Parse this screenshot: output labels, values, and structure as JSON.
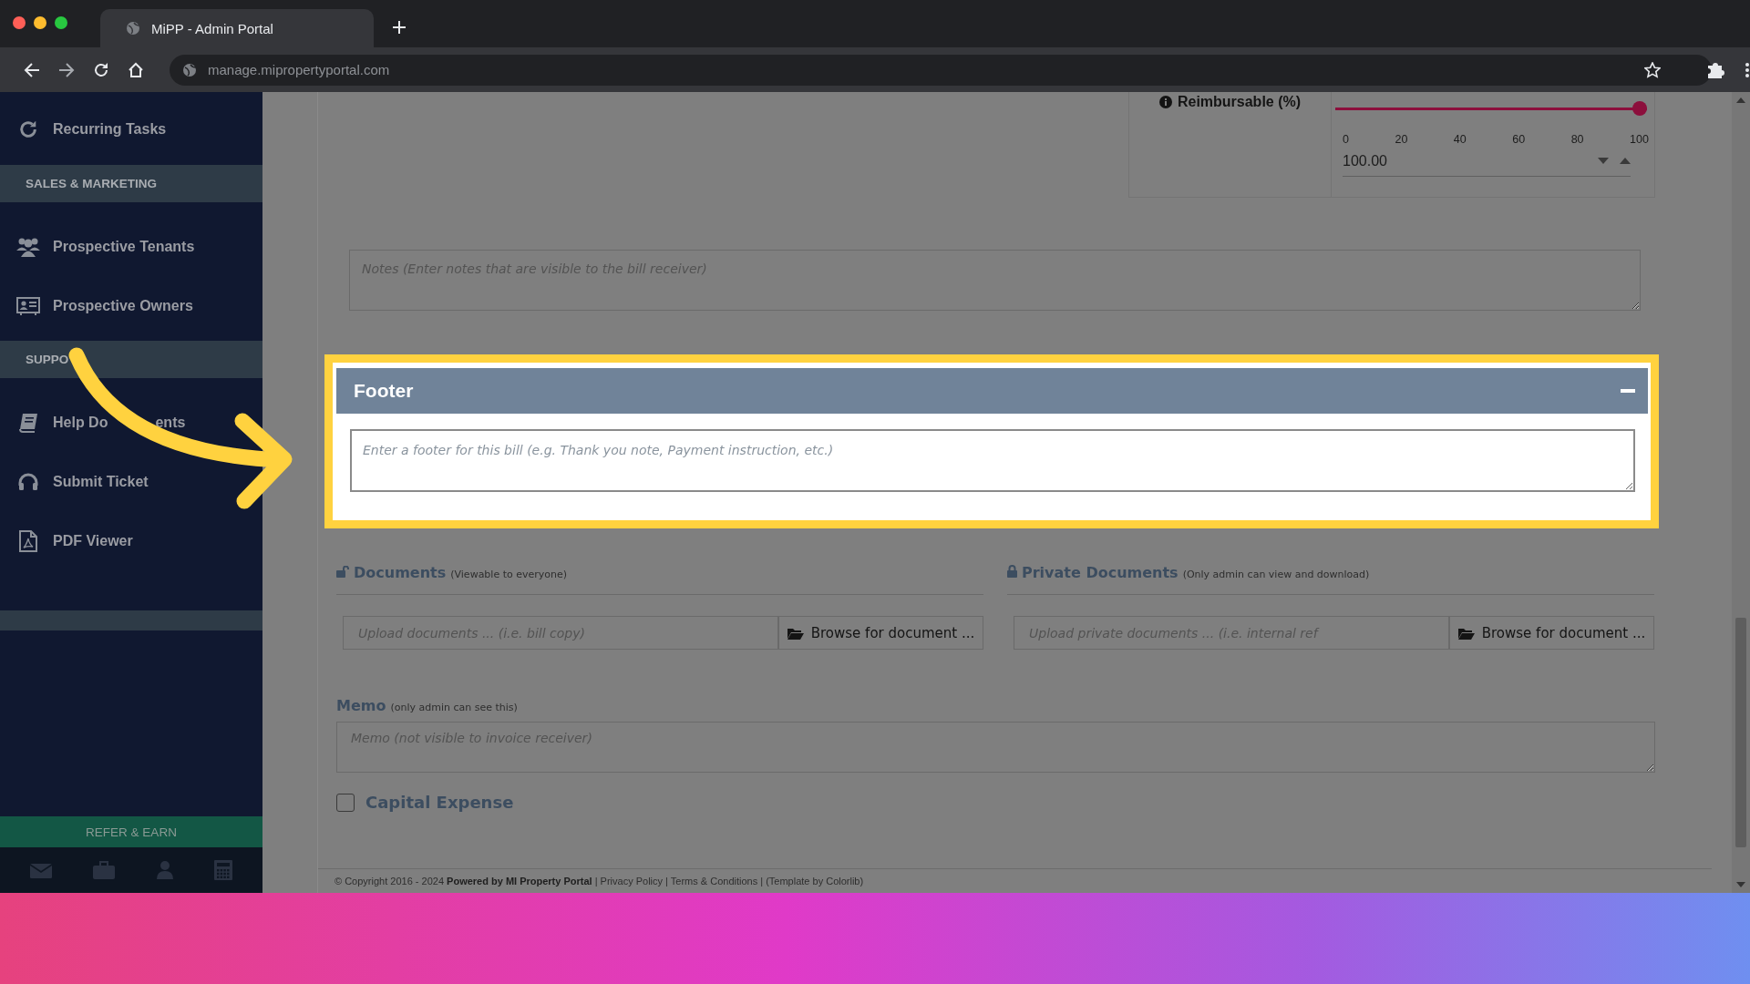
{
  "browser": {
    "tab_title": "MiPP - Admin Portal",
    "url": "manage.mipropertyportal.com"
  },
  "sidebar": {
    "items": [
      {
        "kind": "item",
        "label": "Recurring Tasks"
      },
      {
        "kind": "header",
        "label": "SALES & MARKETING"
      },
      {
        "kind": "item",
        "label": "Prospective Tenants"
      },
      {
        "kind": "item",
        "label": "Prospective Owners"
      },
      {
        "kind": "header",
        "label": "SUPPO"
      },
      {
        "kind": "item",
        "label": "Help Do",
        "label_tail": "ents"
      },
      {
        "kind": "item",
        "label": "Submit Ticket"
      },
      {
        "kind": "item",
        "label": "PDF Viewer"
      },
      {
        "kind": "divider"
      }
    ],
    "refer_button": "REFER & EARN"
  },
  "reimbursable": {
    "label": "Reimbursable (%)",
    "level": 1,
    "ticks": [
      "0",
      "20",
      "40",
      "60",
      "80",
      "100"
    ],
    "value": "100.00"
  },
  "notes": {
    "placeholder": "Notes (Enter notes that are visible to the bill receiver)"
  },
  "footer_panel": {
    "title": "Footer",
    "highlighted": true,
    "expanded": true,
    "placeholder": "Enter a footer for this bill (e.g. Thank you note, Payment instruction, etc.)"
  },
  "documents": [
    {
      "title": "Documents",
      "note": "(Viewable to everyone)",
      "locked": false,
      "placeholder": "Upload documents ... (i.e. bill copy)",
      "button": "Browse for document ..."
    },
    {
      "title": "Private Documents",
      "note": "(Only admin can view and download)",
      "locked": true,
      "placeholder": "Upload private documents ... (i.e. internal ref",
      "button": "Browse for document ..."
    }
  ],
  "memo": {
    "label": "Memo",
    "note": "(only admin can see this)",
    "placeholder": "Memo (not visible to invoice receiver)"
  },
  "capital_expense": {
    "label": "Capital Expense",
    "checked": false
  },
  "copyright": "© Copyright 2016 - 2024 **Powered by MI Property Portal** | Privacy Policy | Terms & Conditions | (Template by Colorlib)"
}
